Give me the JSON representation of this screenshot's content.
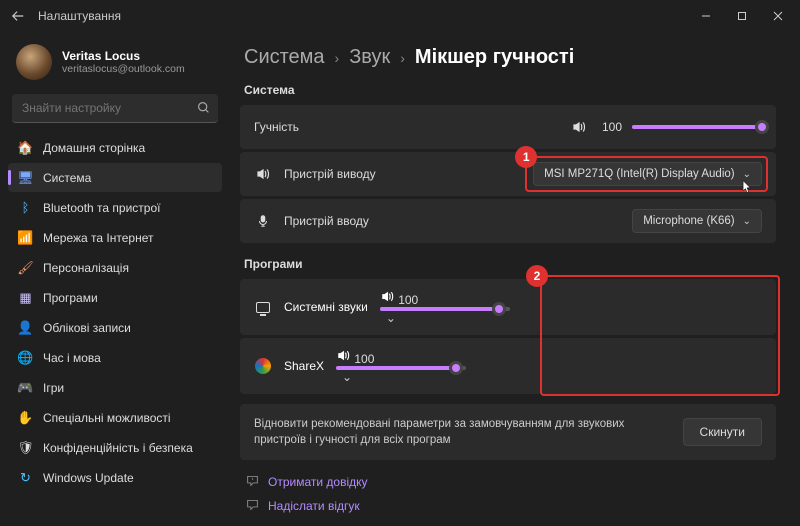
{
  "titlebar": {
    "title": "Налаштування"
  },
  "profile": {
    "name": "Veritas Locus",
    "email": "veritaslocus@outlook.com"
  },
  "search": {
    "placeholder": "Знайти настройку"
  },
  "nav": [
    {
      "icon": "🏠",
      "label": "Домашня сторінка",
      "color": "#4cc2ff"
    },
    {
      "icon": "🖥",
      "label": "Система",
      "color": "#7aa7ff",
      "active": true
    },
    {
      "icon": "ᛒ",
      "label": "Bluetooth та пристрої",
      "color": "#4cc2ff"
    },
    {
      "icon": "📶",
      "label": "Мережа та Інтернет",
      "color": "#2dd4bf"
    },
    {
      "icon": "🖌",
      "label": "Персоналізація",
      "color": "#ff9e6b"
    },
    {
      "icon": "▦",
      "label": "Програми",
      "color": "#cfc3ff"
    },
    {
      "icon": "👤",
      "label": "Облікові записи",
      "color": "#7dd3fc"
    },
    {
      "icon": "🌐",
      "label": "Час і мова",
      "color": "#a3e0ff"
    },
    {
      "icon": "🎮",
      "label": "Ігри",
      "color": "#bbb"
    },
    {
      "icon": "✋",
      "label": "Спеціальні можливості",
      "color": "#9be7ff"
    },
    {
      "icon": "🛡",
      "label": "Конфіденційність і безпека",
      "color": "#ddd"
    },
    {
      "icon": "↻",
      "label": "Windows Update",
      "color": "#4cc2ff"
    }
  ],
  "breadcrumb": {
    "a": "Система",
    "b": "Звук",
    "c": "Мікшер гучності"
  },
  "sections": {
    "system": "Система",
    "apps": "Програми"
  },
  "volume": {
    "label": "Гучність",
    "value": "100",
    "pct": 100
  },
  "output": {
    "label": "Пристрій виводу",
    "value": "MSI MP271Q (Intel(R) Display Audio)"
  },
  "input": {
    "label": "Пристрій вводу",
    "value": "Microphone (K66)"
  },
  "apps": [
    {
      "name": "Системні звуки",
      "value": "100",
      "pct": 92,
      "type": "monitor"
    },
    {
      "name": "ShareX",
      "value": "100",
      "pct": 92,
      "type": "sharex"
    }
  ],
  "reset": {
    "text": "Відновити рекомендовані параметри за замовчуванням для звукових пристроїв і гучності для всіх програм",
    "button": "Скинути"
  },
  "links": {
    "help": "Отримати довідку",
    "feedback": "Надіслати відгук"
  },
  "callouts": {
    "one": "1",
    "two": "2"
  }
}
